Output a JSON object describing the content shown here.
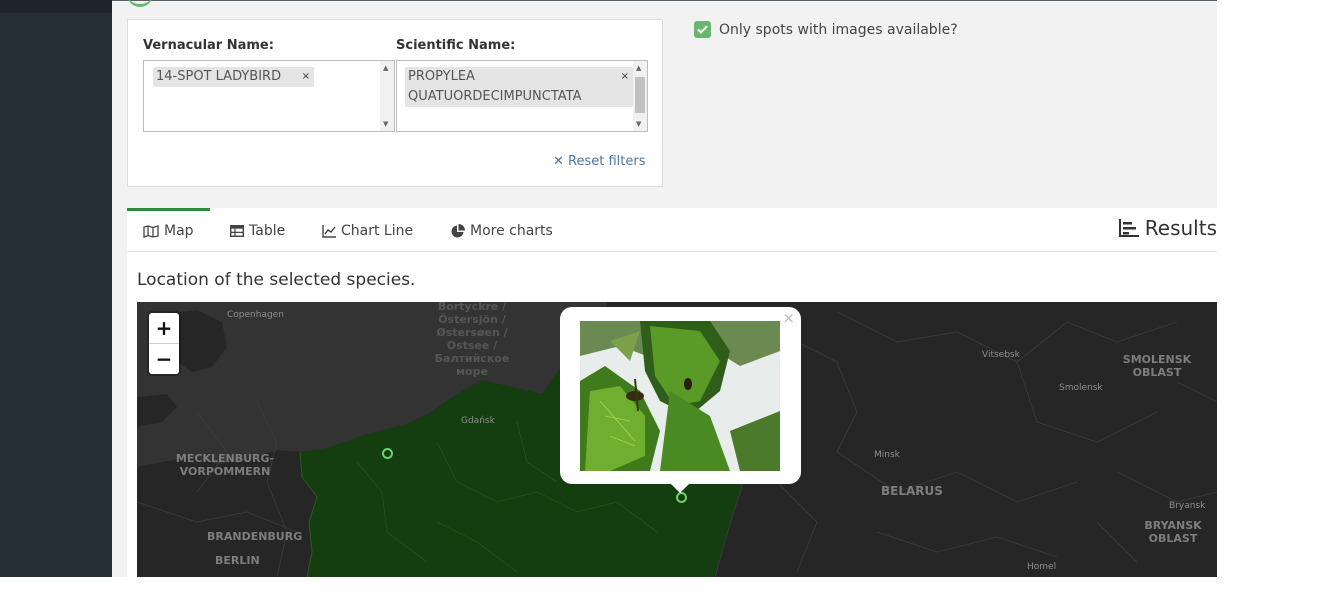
{
  "filters": {
    "vernacular_label": "Vernacular Name:",
    "vernacular_tag": "14-SPOT LADYBIRD",
    "scientific_label": "Scientific Name:",
    "scientific_tag_line1": "PROPYLEA",
    "scientific_tag_line2": "QUATUORDECIMPUNCTATA",
    "remove_symbol": "×",
    "reset_label": "Reset filters"
  },
  "images_only": {
    "label": "Only spots with images available?",
    "checked": true
  },
  "tabs": [
    {
      "label": "Map",
      "icon": "map-icon",
      "active": true
    },
    {
      "label": "Table",
      "icon": "table-icon"
    },
    {
      "label": "Chart Line",
      "icon": "chart-line-icon"
    },
    {
      "label": "More charts",
      "icon": "pie-chart-icon"
    }
  ],
  "results_label": "Results",
  "map_caption": "Location of the selected species.",
  "map": {
    "zoom_in": "+",
    "zoom_out": "−",
    "popup_close": "×",
    "labels": {
      "copenhagen": "Copenhagen",
      "baltic_1": "Bortyckre /",
      "baltic_2": "Östersjön /",
      "baltic_3": "Østersøen /",
      "baltic_4": "Ostsee /",
      "baltic_5": "Балтийское",
      "baltic_6": "море",
      "gdansk": "Gdańsk",
      "mecklenburg_1": "MECKLENBURG-",
      "mecklenburg_2": "VORPOMMERN",
      "brandenburg": "BRANDENBURG",
      "berlin": "BERLIN",
      "vitsebsk": "Vitsebsk",
      "smolensk_oblast_1": "SMOLENSK",
      "smolensk_oblast_2": "OBLAST",
      "smolensk": "Smolensk",
      "minsk": "Minsk",
      "belarus": "BELARUS",
      "bryansk": "Bryansk",
      "bryansk_oblast_1": "BRYANSK",
      "bryansk_oblast_2": "OBLAST",
      "homel": "Homel"
    }
  },
  "colors": {
    "accent": "#69b76e",
    "tab_active": "#2f8a36",
    "link": "#4a77a8",
    "sidebar": "#253035",
    "map_bg": "#262626",
    "map_poland": "#143d10"
  }
}
